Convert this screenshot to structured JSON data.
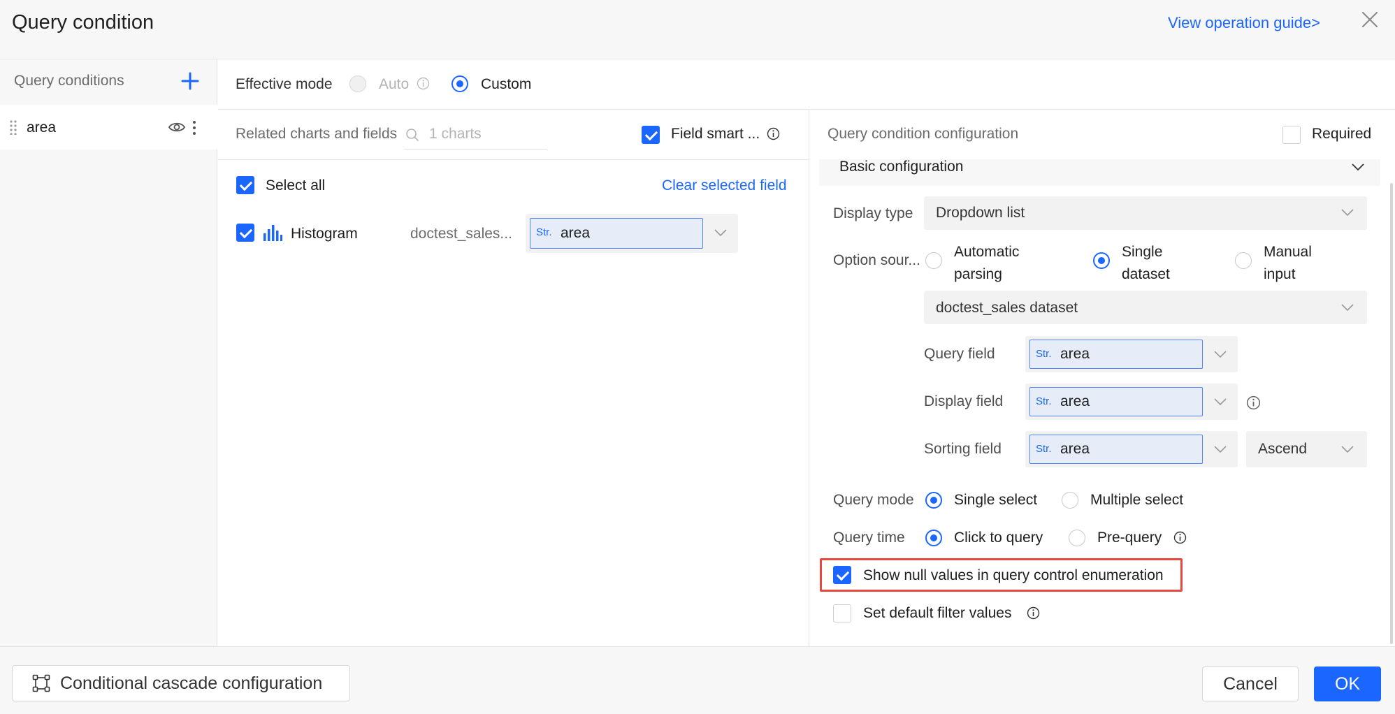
{
  "header": {
    "title": "Query condition",
    "guide_link": "View operation guide>"
  },
  "sidebar": {
    "heading": "Query conditions",
    "items": [
      {
        "label": "area"
      }
    ]
  },
  "mode": {
    "label": "Effective mode",
    "options": [
      {
        "label": "Auto",
        "selected": false,
        "disabled": true
      },
      {
        "label": "Custom",
        "selected": true
      }
    ]
  },
  "related": {
    "label": "Related charts and fields",
    "search_placeholder": "1 charts",
    "field_smart_label": "Field smart ...",
    "field_smart_checked": true,
    "select_all_label": "Select all",
    "select_all_checked": true,
    "clear_link": "Clear selected field",
    "charts": [
      {
        "checked": true,
        "type_icon": "histogram-icon",
        "name": "Histogram",
        "dataset": "doctest_sales...",
        "field_type": "Str.",
        "field": "area"
      }
    ]
  },
  "config": {
    "header_label": "Query condition configuration",
    "required_label": "Required",
    "required_checked": false,
    "section_label": "Basic configuration",
    "display_type_label": "Display type",
    "display_type_value": "Dropdown list",
    "option_source_label": "Option sour...",
    "option_source": [
      {
        "line1": "Automatic",
        "line2": "parsing",
        "selected": false
      },
      {
        "line1": "Single",
        "line2": "dataset",
        "selected": true
      },
      {
        "line1": "Manual",
        "line2": "input",
        "selected": false
      }
    ],
    "dataset_value": "doctest_sales dataset",
    "query_field_label": "Query field",
    "display_field_label": "Display field",
    "sorting_field_label": "Sorting field",
    "field_type": "Str.",
    "query_field_value": "area",
    "display_field_value": "area",
    "sorting_field_value": "area",
    "sort_order": "Ascend",
    "query_mode_label": "Query mode",
    "query_mode_options": [
      {
        "label": "Single select",
        "selected": true
      },
      {
        "label": "Multiple select",
        "selected": false
      }
    ],
    "query_time_label": "Query time",
    "query_time_options": [
      {
        "label": "Click to query",
        "selected": true
      },
      {
        "label": "Pre-query",
        "selected": false
      }
    ],
    "show_null_label": "Show null values in query control enumeration",
    "show_null_checked": true,
    "default_filter_label": "Set default filter values",
    "default_filter_checked": false
  },
  "footer": {
    "cascade_label": "Conditional cascade configuration",
    "cancel_label": "Cancel",
    "ok_label": "OK"
  },
  "colors": {
    "accent": "#1a66ff",
    "highlight_border": "#e8483d",
    "panel_bg": "#f7f7f7"
  }
}
